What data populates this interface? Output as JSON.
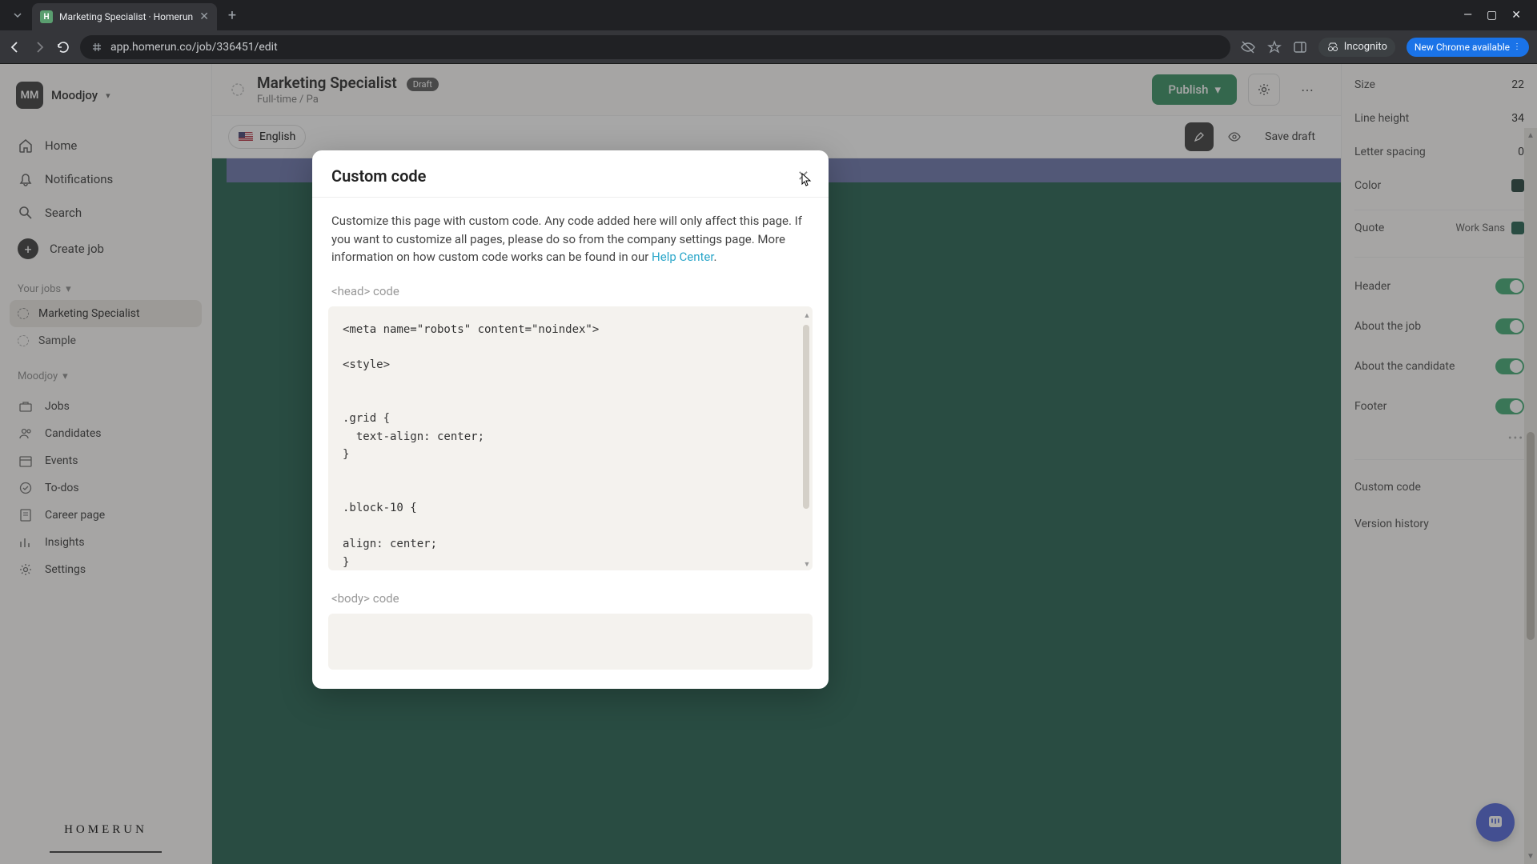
{
  "browser": {
    "tab_title": "Marketing Specialist · Homerun",
    "url": "app.homerun.co/job/336451/edit",
    "incognito": "Incognito",
    "new_chrome": "New Chrome available"
  },
  "workspace": {
    "initials": "MM",
    "name": "Moodjoy"
  },
  "nav": {
    "home": "Home",
    "notifications": "Notifications",
    "search": "Search",
    "create": "Create job"
  },
  "sections": {
    "your_jobs": "Your jobs",
    "moodjoy": "Moodjoy"
  },
  "jobs": {
    "marketing": "Marketing Specialist",
    "sample": "Sample"
  },
  "secondary": {
    "jobs": "Jobs",
    "candidates": "Candidates",
    "events": "Events",
    "todos": "To-dos",
    "career": "Career page",
    "insights": "Insights",
    "settings": "Settings"
  },
  "logo": "HOMERUN",
  "topbar": {
    "title": "Marketing Specialist",
    "badge": "Draft",
    "meta": "Full-time / Pa",
    "publish": "Publish"
  },
  "subbar": {
    "lang": "English",
    "save": "Save draft"
  },
  "panel": {
    "size_label": "Size",
    "size_val": "22",
    "lineheight_label": "Line height",
    "lineheight_val": "34",
    "letterspacing_label": "Letter spacing",
    "letterspacing_val": "0",
    "color_label": "Color",
    "quote_label": "Quote",
    "quote_font": "Work Sans",
    "header": "Header",
    "about_job": "About the job",
    "about_candidate": "About the candidate",
    "footer": "Footer",
    "custom_code": "Custom code",
    "version_history": "Version history"
  },
  "modal": {
    "title": "Custom code",
    "desc_1": "Customize this page with custom code. Any code added here will only affect this page. If you want to customize all pages, please do so from the company settings page. More information on how custom code works can be found in our ",
    "help_link": "Help Center",
    "desc_2": ".",
    "head_label": "<head> code",
    "head_code": "<meta name=\"robots\" content=\"noindex\">\n\n<style>\n\n\n.grid {\n  text-align: center;\n}\n\n\n.block-10 {\n\nalign: center;\n}",
    "body_label": "<body> code"
  }
}
